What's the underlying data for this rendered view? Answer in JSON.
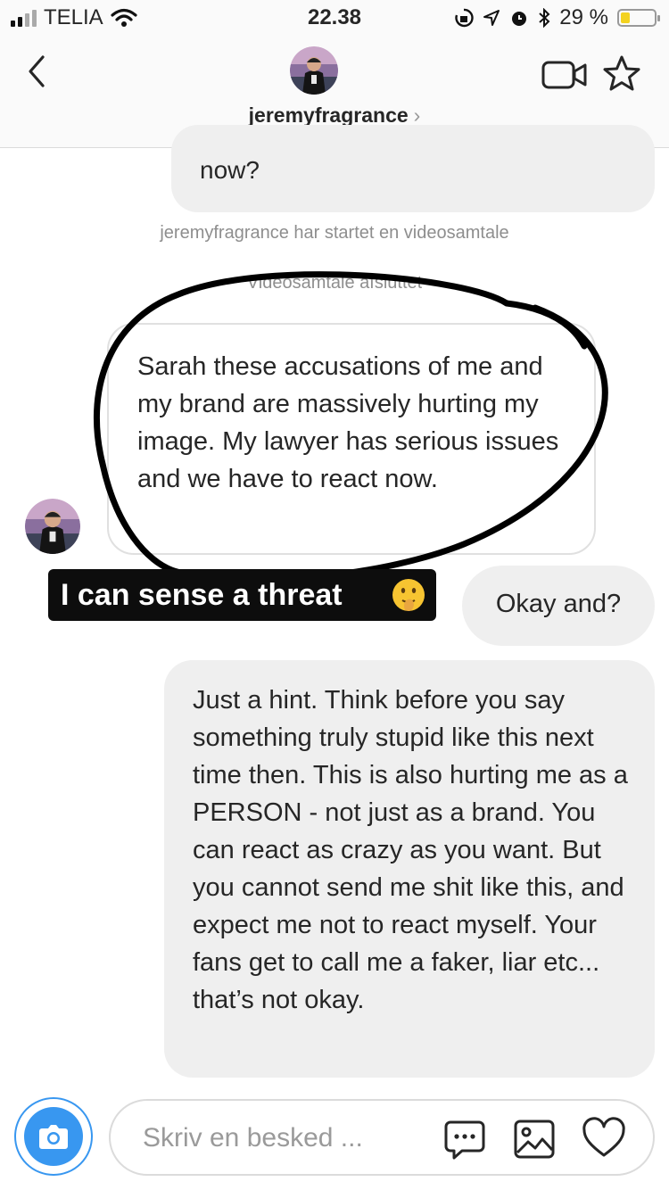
{
  "status_bar": {
    "carrier": "TELIA",
    "time": "22.38",
    "battery": "29 %",
    "battery_level": 0.29
  },
  "header": {
    "username": "jeremyfragrance",
    "chevron": "›"
  },
  "messages": {
    "partial_text": "now?",
    "system_1": "jeremyfragrance har startet en videosamtale",
    "system_2": "Videosamtale afsluttet",
    "incoming_1": "Sarah these accusations of me and my brand are massively hurting my image. My lawyer has serious issues and we have to react now.",
    "outgoing_1": "Okay and?",
    "outgoing_2": "Just a hint. Think before you say something truly stupid like this next time then. This is also hurting me as a PERSON - not just as a brand. You can react as crazy as you want. But you cannot send me shit like this, and expect me not to react myself. Your fans get to call me a faker, liar etc... that’s not okay."
  },
  "sticker": {
    "text": "I can sense a threat"
  },
  "composer": {
    "placeholder": "Skriv en besked ..."
  },
  "colors": {
    "accent": "#3897f0",
    "bubble": "#efefef",
    "battery": "#f3d21f"
  },
  "icons": [
    "back-icon",
    "video-call-icon",
    "star-icon",
    "camera-icon",
    "chat-icon",
    "gallery-icon",
    "heart-icon",
    "wifi-icon",
    "location-icon",
    "alarm-icon",
    "bluetooth-icon"
  ]
}
